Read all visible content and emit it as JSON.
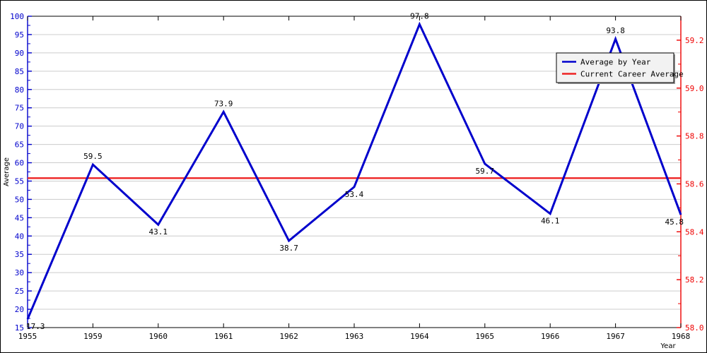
{
  "chart_data": {
    "type": "line",
    "title": "",
    "xlabel": "Year",
    "ylabel": "Average",
    "categories": [
      "1955",
      "1959",
      "1960",
      "1961",
      "1962",
      "1963",
      "1964",
      "1965",
      "1966",
      "1967",
      "1968"
    ],
    "series": [
      {
        "name": "Average by Year",
        "color": "#0000cc",
        "values": [
          17.3,
          59.5,
          43.1,
          73.9,
          38.7,
          53.4,
          97.8,
          59.7,
          46.1,
          93.8,
          45.8
        ],
        "point_labels": [
          "17.3",
          "59.5",
          "43.1",
          "73.9",
          "38.7",
          "53.4",
          "97.8",
          "59.7",
          "46.1",
          "93.8",
          "45.8"
        ]
      },
      {
        "name": "Current Career Average",
        "color": "#ee2222",
        "type": "hline",
        "value": 55.8
      }
    ],
    "left_axis": {
      "color": "#0000cc",
      "ylim": [
        15,
        100
      ],
      "ticks": [
        15,
        20,
        25,
        30,
        35,
        40,
        45,
        50,
        55,
        60,
        65,
        70,
        75,
        80,
        85,
        90,
        95,
        100
      ],
      "tick_labels": [
        "15",
        "20",
        "25",
        "30",
        "35",
        "40",
        "45",
        "50",
        "55",
        "60",
        "65",
        "70",
        "75",
        "80",
        "85",
        "90",
        "95",
        "100"
      ],
      "label": "Average"
    },
    "right_axis": {
      "color": "#ee0000",
      "ylim": [
        58.0,
        59.3
      ],
      "ticks": [
        58.0,
        58.2,
        58.4,
        58.6,
        58.8,
        59.0,
        59.2
      ],
      "tick_labels": [
        "58.0",
        "58.2",
        "58.4",
        "58.6",
        "58.8",
        "59.0",
        "59.2"
      ]
    },
    "grid": true,
    "grid_color": "#cccccc",
    "legend_position": "top-right",
    "legend": [
      {
        "label": "Average by Year",
        "color": "#0000cc"
      },
      {
        "label": "Current Career Average",
        "color": "#ee2222"
      }
    ]
  }
}
